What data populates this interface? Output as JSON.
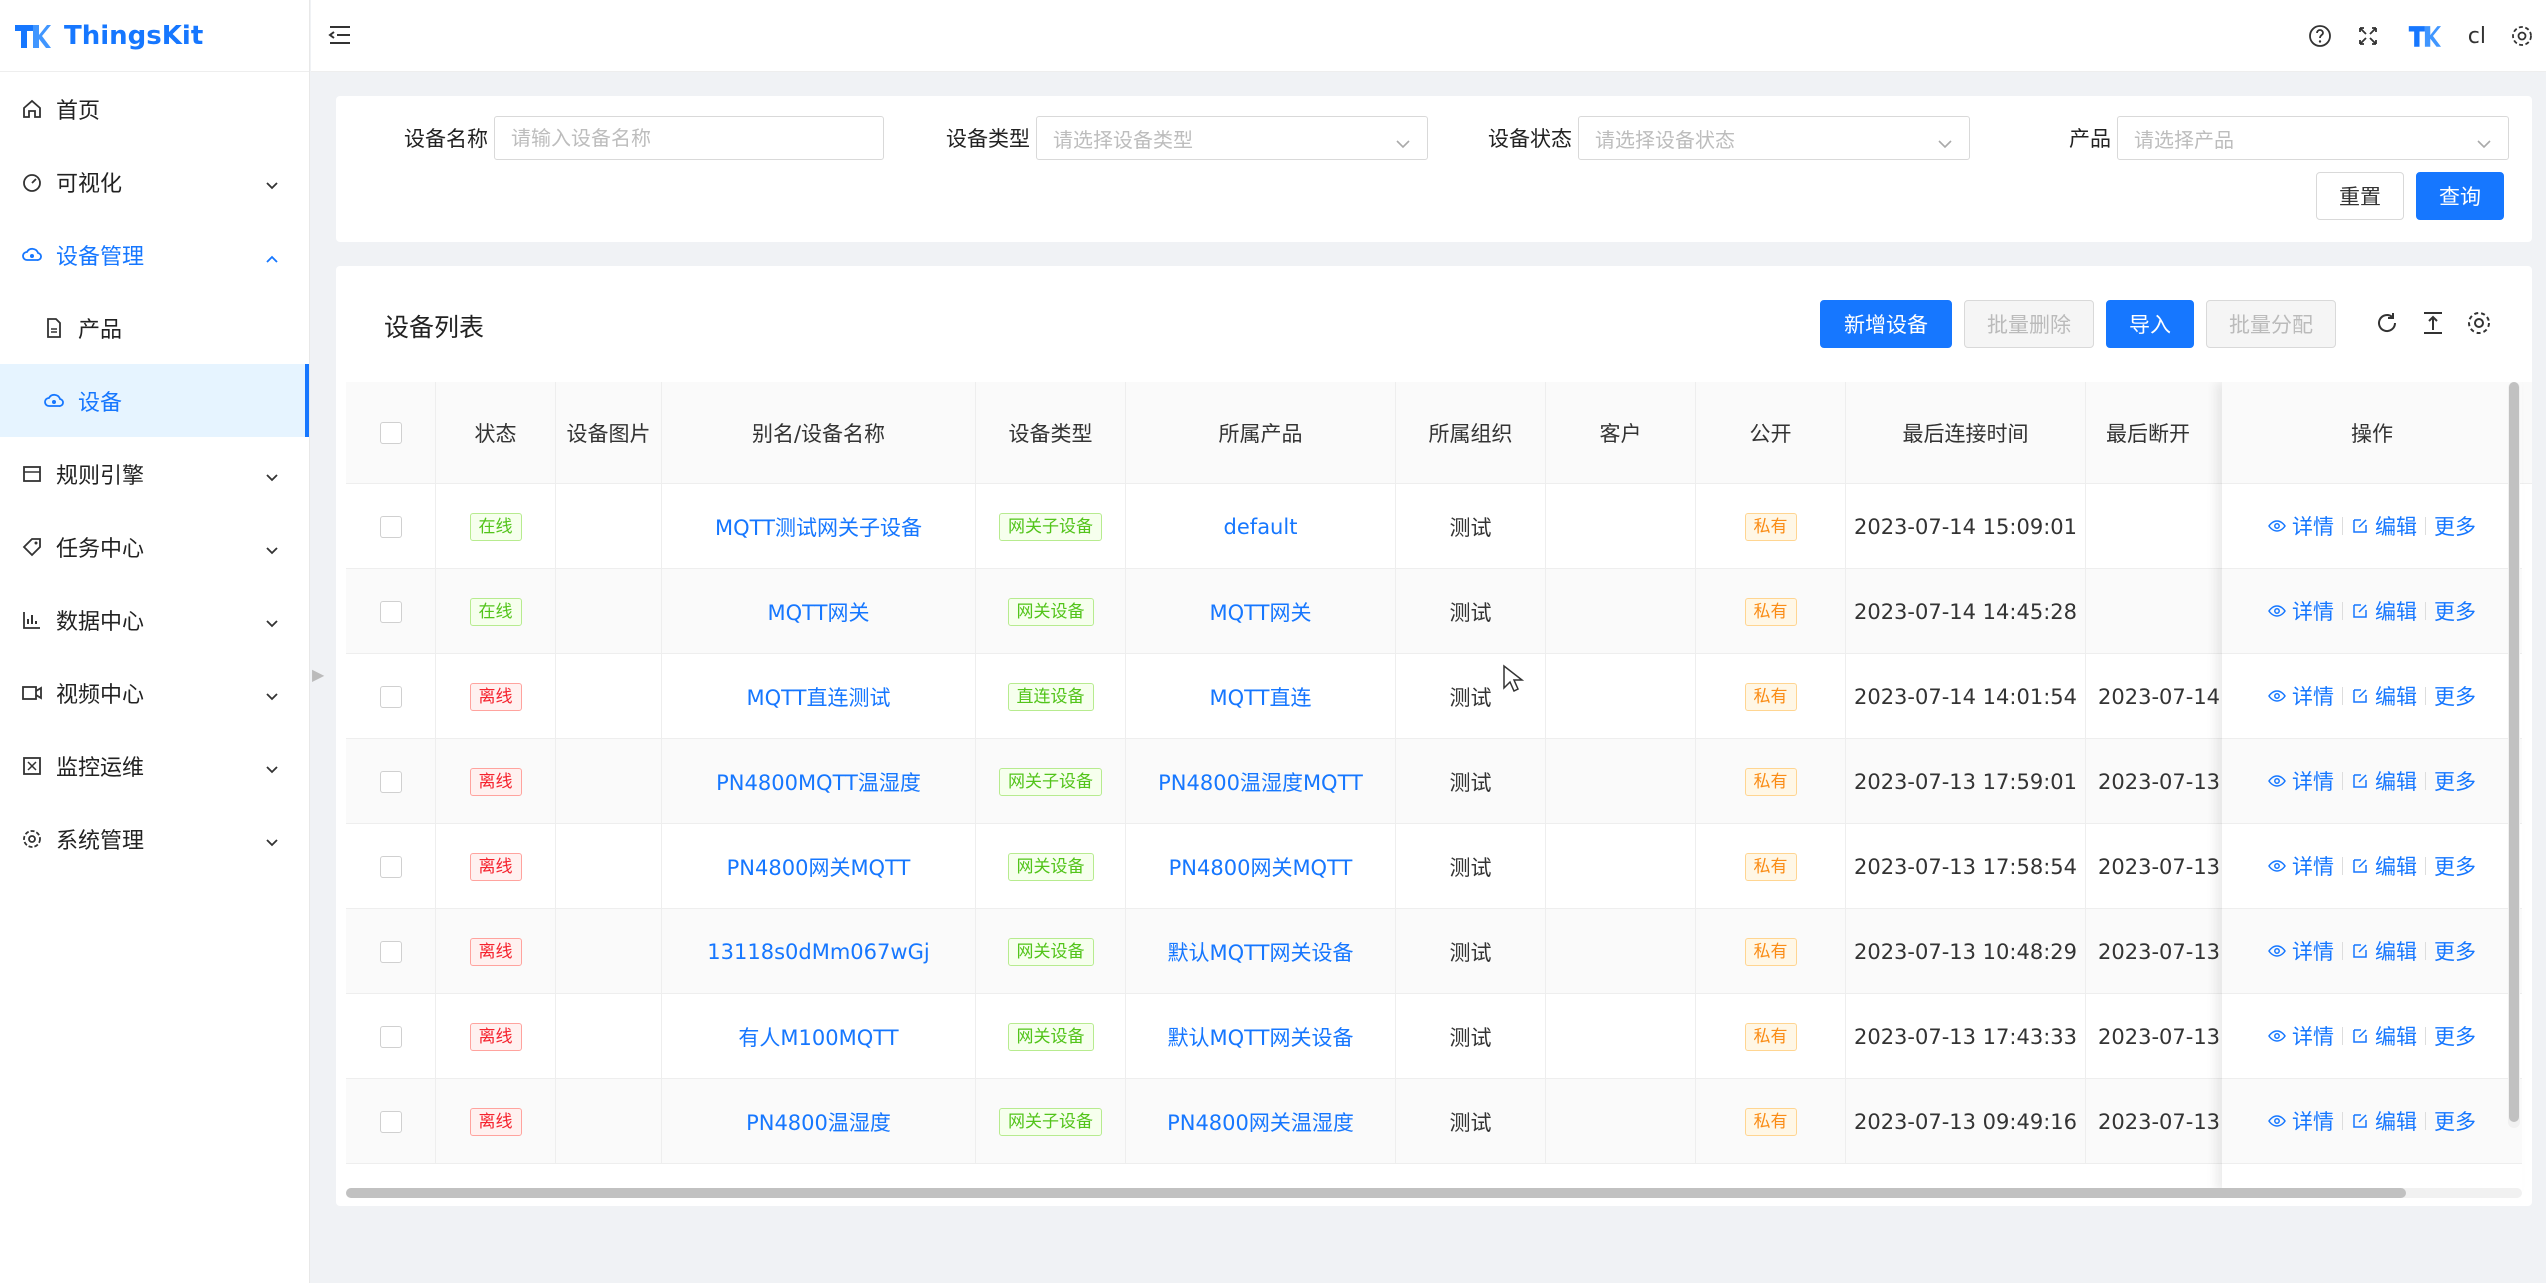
{
  "app": {
    "brand": "ThingsKit"
  },
  "sidebar": {
    "items": [
      {
        "label": "首页",
        "icon": "home-icon"
      },
      {
        "label": "可视化",
        "icon": "dashboard-icon"
      },
      {
        "label": "设备管理",
        "icon": "cloud-device-icon"
      },
      {
        "label": "产品",
        "icon": "file-icon"
      },
      {
        "label": "设备",
        "icon": "cloud-device-icon"
      },
      {
        "label": "规则引擎",
        "icon": "rule-icon"
      },
      {
        "label": "任务中心",
        "icon": "tag-icon"
      },
      {
        "label": "数据中心",
        "icon": "bar-chart-icon"
      },
      {
        "label": "视频中心",
        "icon": "video-icon"
      },
      {
        "label": "监控运维",
        "icon": "monitor-icon"
      },
      {
        "label": "系统管理",
        "icon": "gear-icon"
      }
    ]
  },
  "header": {
    "user": "cl"
  },
  "search": {
    "device_name_label": "设备名称",
    "device_name_placeholder": "请输入设备名称",
    "device_type_label": "设备类型",
    "device_type_placeholder": "请选择设备类型",
    "device_status_label": "设备状态",
    "device_status_placeholder": "请选择设备状态",
    "product_label": "产品",
    "product_placeholder": "请选择产品",
    "reset": "重置",
    "query": "查询"
  },
  "table": {
    "title": "设备列表",
    "buttons": {
      "add": "新增设备",
      "batch_delete": "批量删除",
      "import": "导入",
      "batch_assign": "批量分配"
    },
    "columns": [
      "状态",
      "设备图片",
      "别名/设备名称",
      "设备类型",
      "所属产品",
      "所属组织",
      "客户",
      "公开",
      "最后连接时间",
      "最后断开",
      "操作"
    ],
    "row_actions": {
      "detail": "详情",
      "edit": "编辑",
      "more": "更多"
    },
    "rows": [
      {
        "status": "在线",
        "status_color": "green",
        "name": "MQTT测试网关子设备",
        "type": "网关子设备",
        "product": "default",
        "org": "测试",
        "public": "私有",
        "last_connect": "2023-07-14 15:09:01",
        "last_disconnect": ""
      },
      {
        "status": "在线",
        "status_color": "green",
        "name": "MQTT网关",
        "type": "网关设备",
        "product": "MQTT网关",
        "org": "测试",
        "public": "私有",
        "last_connect": "2023-07-14 14:45:28",
        "last_disconnect": ""
      },
      {
        "status": "离线",
        "status_color": "red",
        "name": "MQTT直连测试",
        "type": "直连设备",
        "product": "MQTT直连",
        "org": "测试",
        "public": "私有",
        "last_connect": "2023-07-14 14:01:54",
        "last_disconnect": "2023-07-14"
      },
      {
        "status": "离线",
        "status_color": "red",
        "name": "PN4800MQTT温湿度",
        "type": "网关子设备",
        "product": "PN4800温湿度MQTT",
        "org": "测试",
        "public": "私有",
        "last_connect": "2023-07-13 17:59:01",
        "last_disconnect": "2023-07-13"
      },
      {
        "status": "离线",
        "status_color": "red",
        "name": "PN4800网关MQTT",
        "type": "网关设备",
        "product": "PN4800网关MQTT",
        "org": "测试",
        "public": "私有",
        "last_connect": "2023-07-13 17:58:54",
        "last_disconnect": "2023-07-13"
      },
      {
        "status": "离线",
        "status_color": "red",
        "name": "13118s0dMm067wGj",
        "type": "网关设备",
        "product": "默认MQTT网关设备",
        "org": "测试",
        "public": "私有",
        "last_connect": "2023-07-13 10:48:29",
        "last_disconnect": "2023-07-13"
      },
      {
        "status": "离线",
        "status_color": "red",
        "name": "有人M100MQTT",
        "type": "网关设备",
        "product": "默认MQTT网关设备",
        "org": "测试",
        "public": "私有",
        "last_connect": "2023-07-13 17:43:33",
        "last_disconnect": "2023-07-13"
      },
      {
        "status": "离线",
        "status_color": "red",
        "name": "PN4800温湿度",
        "type": "网关子设备",
        "product": "PN4800网关温湿度",
        "org": "测试",
        "public": "私有",
        "last_connect": "2023-07-13 09:49:16",
        "last_disconnect": "2023-07-13"
      }
    ]
  }
}
